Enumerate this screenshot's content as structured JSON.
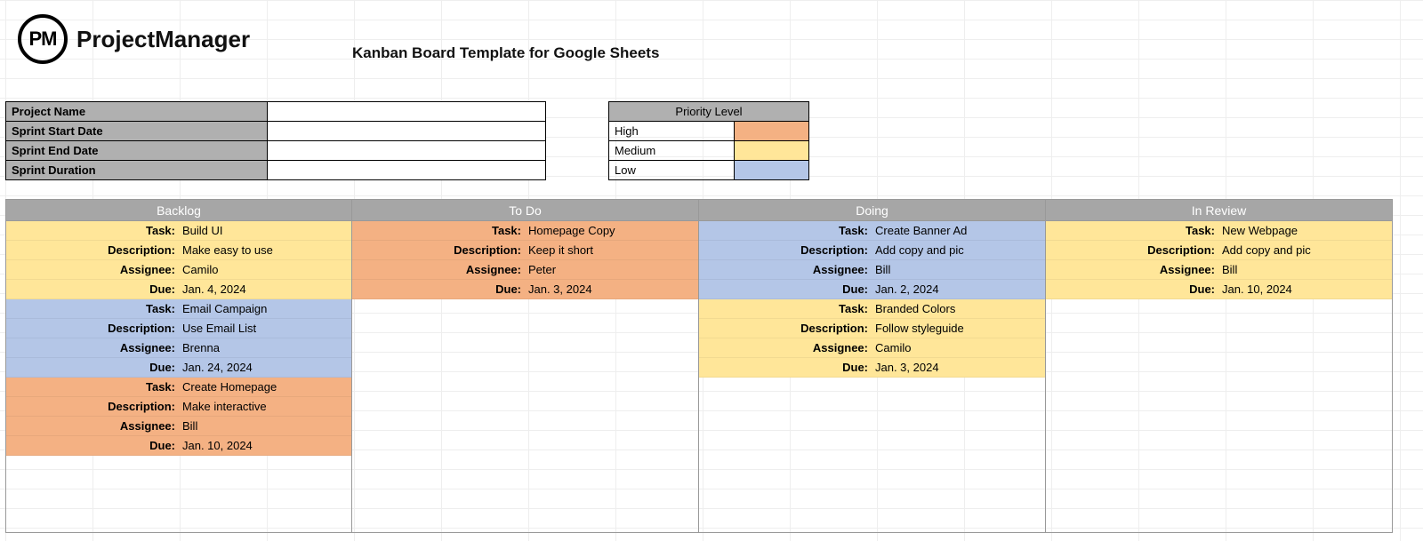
{
  "brand": {
    "mark": "PM",
    "name": "ProjectManager"
  },
  "title": "Kanban Board Template for Google Sheets",
  "meta": {
    "fields": [
      {
        "label": "Project Name",
        "value": ""
      },
      {
        "label": "Sprint Start Date",
        "value": ""
      },
      {
        "label": "Sprint End Date",
        "value": ""
      },
      {
        "label": "Sprint Duration",
        "value": ""
      }
    ]
  },
  "priority": {
    "header": "Priority Level",
    "levels": [
      {
        "name": "High",
        "color": "#f4b183"
      },
      {
        "name": "Medium",
        "color": "#ffe699"
      },
      {
        "name": "Low",
        "color": "#b4c6e7"
      }
    ]
  },
  "card_field_labels": {
    "task": "Task:",
    "description": "Description:",
    "assignee": "Assignee:",
    "due": "Due:"
  },
  "columns": [
    {
      "title": "Backlog",
      "cards": [
        {
          "priority": "Medium",
          "task": "Build UI",
          "description": "Make easy to use",
          "assignee": "Camilo",
          "due": "Jan. 4, 2024"
        },
        {
          "priority": "Low",
          "task": "Email Campaign",
          "description": "Use Email List",
          "assignee": "Brenna",
          "due": "Jan. 24, 2024"
        },
        {
          "priority": "High",
          "task": "Create Homepage",
          "description": "Make interactive",
          "assignee": "Bill",
          "due": "Jan. 10, 2024"
        }
      ]
    },
    {
      "title": "To Do",
      "cards": [
        {
          "priority": "High",
          "task": "Homepage Copy",
          "description": "Keep it short",
          "assignee": "Peter",
          "due": "Jan. 3, 2024"
        }
      ]
    },
    {
      "title": "Doing",
      "cards": [
        {
          "priority": "Low",
          "task": "Create Banner Ad",
          "description": "Add copy and pic",
          "assignee": "Bill",
          "due": "Jan. 2, 2024"
        },
        {
          "priority": "Medium",
          "task": "Branded Colors",
          "description": "Follow styleguide",
          "assignee": "Camilo",
          "due": "Jan. 3, 2024"
        }
      ]
    },
    {
      "title": "In Review",
      "cards": [
        {
          "priority": "Medium",
          "task": "New Webpage",
          "description": "Add copy and pic",
          "assignee": "Bill",
          "due": "Jan. 10, 2024"
        }
      ]
    }
  ]
}
